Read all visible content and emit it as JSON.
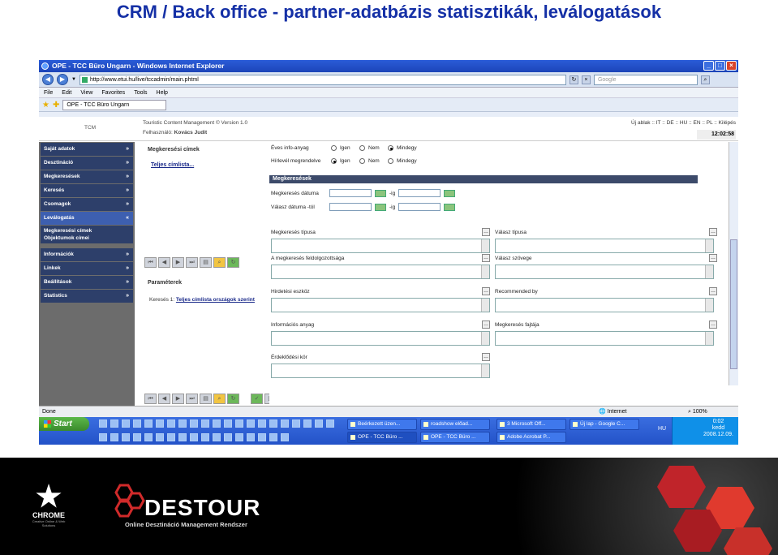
{
  "slide": {
    "title": "CRM / Back office - partner-adatbázis statisztikák, leválogatások"
  },
  "window": {
    "title": "OPE -   TCC Büro Ungarn - Windows Internet Explorer",
    "url": "http://www.etui.hu/live/tccadmin/main.phtml",
    "search_placeholder": "Google",
    "tab_label": "OPE -   TCC Büro Ungarn",
    "menu": [
      "File",
      "Edit",
      "View",
      "Favorites",
      "Tools",
      "Help"
    ]
  },
  "app_header": {
    "logo_text": "TCM",
    "version": "Touristic Content Management © Version 1.0",
    "user_label": "Felhasználó:",
    "user_name": "Kovács Judit",
    "languages": "Új ablak :: IT :: DE :: HU :: EN :: PL :: Kilépés",
    "clock": "12:02:58"
  },
  "sidebar": {
    "items": [
      {
        "label": "Saját adatok"
      },
      {
        "label": "Desztináció"
      },
      {
        "label": "Megkeresések"
      },
      {
        "label": "Keresés"
      },
      {
        "label": "Csomagok"
      },
      {
        "label": "Leválogatás"
      },
      {
        "label": "Információk"
      },
      {
        "label": "Linkek"
      },
      {
        "label": "Beállítások"
      },
      {
        "label": "Statistics"
      }
    ],
    "sub_items": [
      "Megkeresési címek",
      "Objektumok címei"
    ]
  },
  "middle": {
    "title": "Megkeresési címek",
    "link": "Teljes címlista...",
    "params_title": "Paraméterek",
    "search_prefix": "Keresés 1:",
    "search_link": "Teljes címlista országok szerint"
  },
  "form": {
    "info_label": "Éves info-anyag",
    "newsletter_label": "Hírlevél megrendelve",
    "opt_yes": "Igen",
    "opt_no": "Nem",
    "opt_any": "Mindegy",
    "section": "Megkeresések",
    "date_label": "Megkeresés dátuma",
    "reply_date_label": "Válasz dátuma -tól",
    "to_suffix": "-ig",
    "fields_left": [
      "Megkeresés típusa",
      "A megkeresés feldolgozottsága",
      "Hirdetési eszköz",
      "Információs anyag",
      "Érdeklődési kör"
    ],
    "fields_right": [
      "Válasz típusa",
      "Válasz szövege",
      "Recommended by",
      "Megkeresés fajtája"
    ]
  },
  "status": {
    "left": "Done",
    "zone": "Internet",
    "zoom": "100%"
  },
  "taskbar": {
    "start": "Start",
    "tasks_row1": [
      "Beérkezett üzen...",
      "roadshow előad...",
      "3 Microsoft Off...",
      "Új lap - Google C..."
    ],
    "tasks_row2": [
      "OPE -   TCC Büro ...",
      "OPE -  TCC Büro ...",
      "Adobe Acrobat P..."
    ],
    "lang": "HU",
    "time": "0:02",
    "day": "kedd",
    "date": "2008.12.09."
  },
  "footer": {
    "chrome_name": "CHROME",
    "chrome_tag": "Creative Online & Web Solutions",
    "brand": "DESTOUR",
    "brand_sub": "Online Desztináció Management Rendszer"
  }
}
